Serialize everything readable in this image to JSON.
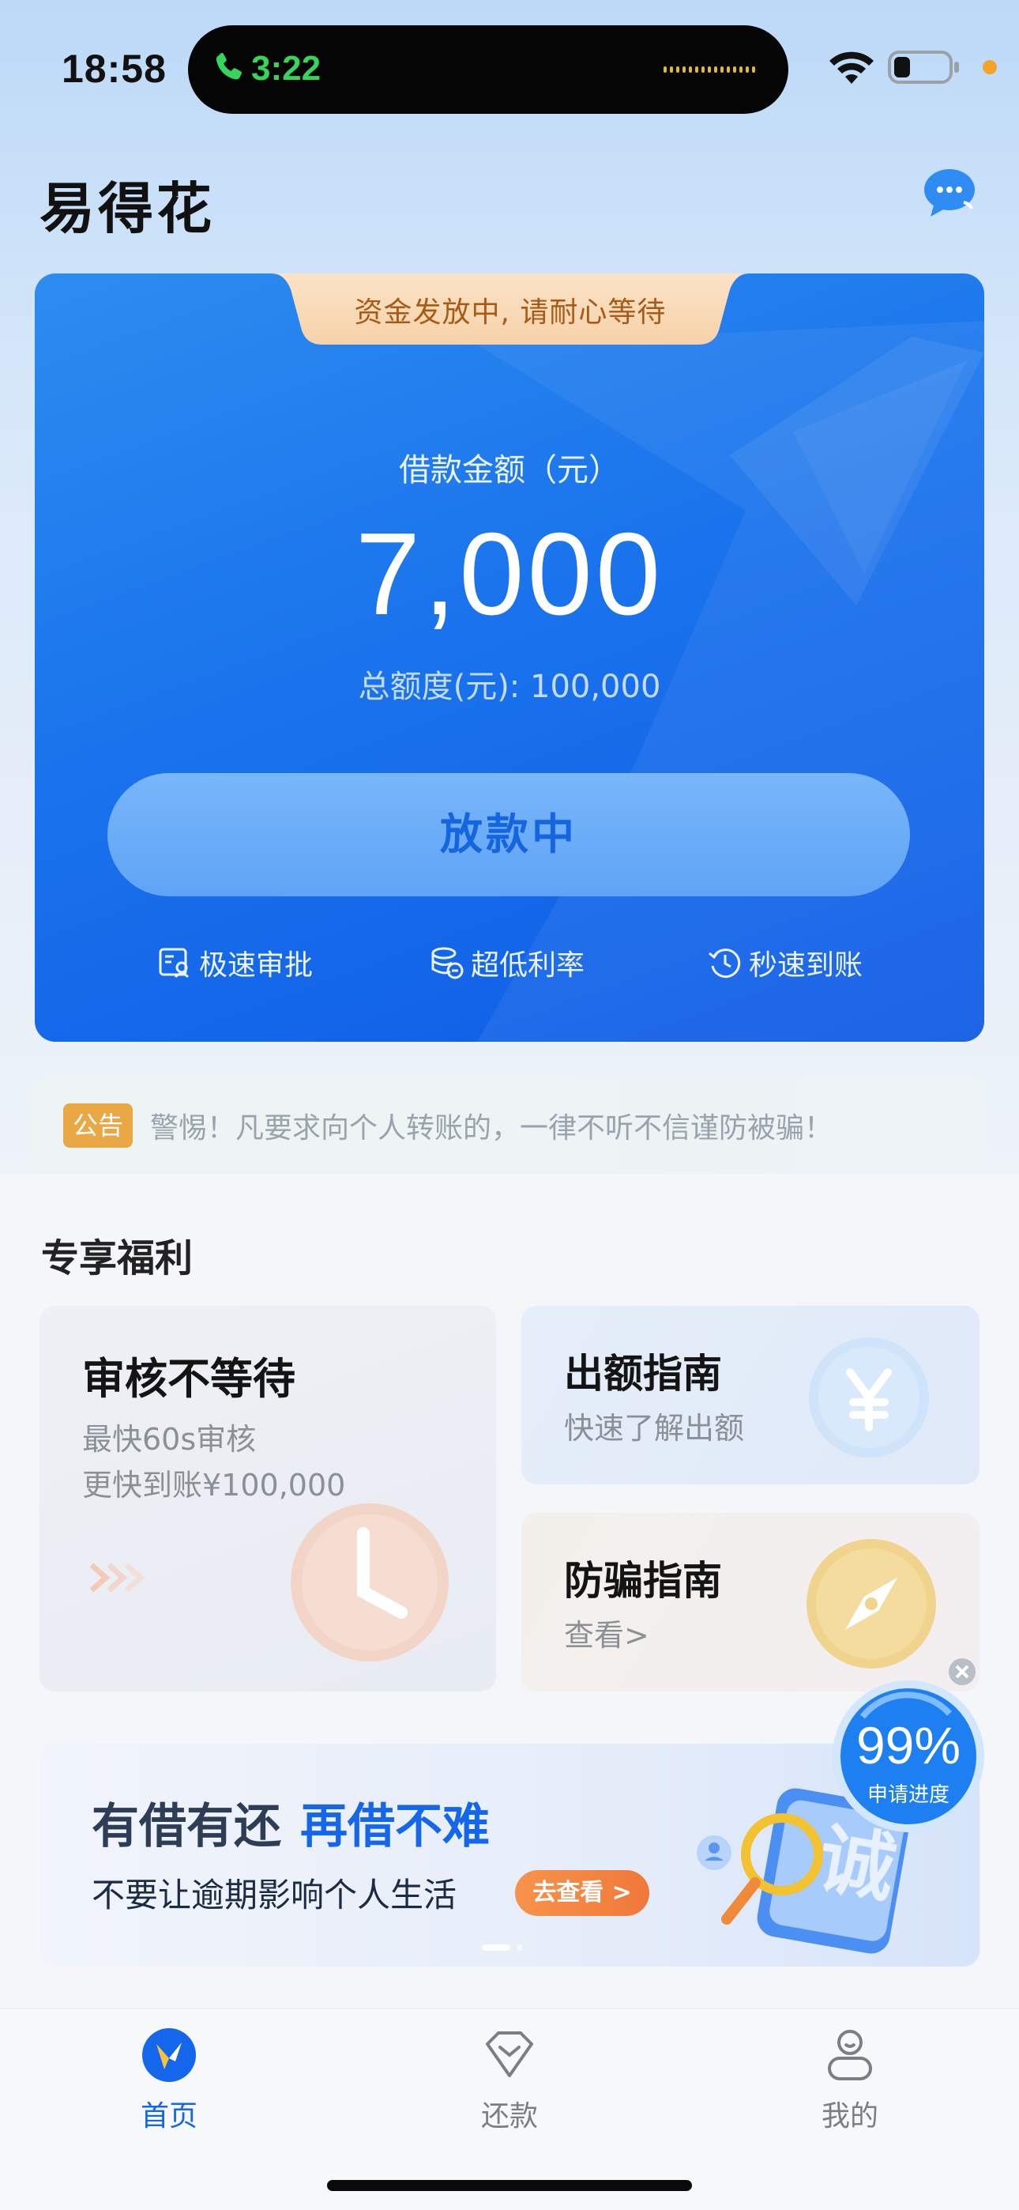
{
  "status_bar": {
    "time": "18:58",
    "call_time": "3:22",
    "call_color": "#35d45a"
  },
  "header": {
    "title": "易得花",
    "icon": "chat-bubble-icon"
  },
  "loan_card": {
    "notice": "资金发放中, 请耐心等待",
    "amount_label": "借款金额（元）",
    "amount": "7,000",
    "total_credit": "总额度(元): 100,000",
    "status_button": "放款中",
    "features": [
      {
        "icon": "review-icon",
        "label": "极速审批"
      },
      {
        "icon": "coins-icon",
        "label": "超低利率"
      },
      {
        "icon": "clock-icon",
        "label": "秒速到账"
      }
    ],
    "accent": "#1a73ec"
  },
  "announcement": {
    "badge": "公告",
    "text": "警惕！凡要求向个人转账的，一律不听不信谨防被骗！"
  },
  "benefits": {
    "title": "专享福利",
    "review_card": {
      "title": "审核不等待",
      "line1": "最快60s审核",
      "line2": "更快到账¥100,000"
    },
    "guide_card": {
      "title": "出额指南",
      "subtitle": "快速了解出额"
    },
    "fraud_card": {
      "title": "防骗指南",
      "subtitle": "查看>"
    }
  },
  "progress_float": {
    "value": "99%",
    "label": "申请进度"
  },
  "banner": {
    "title_part1": "有借有还",
    "title_part2": "再借不难",
    "subtitle": "不要让逾期影响个人生活",
    "button": "去查看 >"
  },
  "tabbar": {
    "items": [
      {
        "label": "首页",
        "icon": "home-logo-icon",
        "active": true
      },
      {
        "label": "还款",
        "icon": "repay-icon",
        "active": false
      },
      {
        "label": "我的",
        "icon": "profile-icon",
        "active": false
      }
    ],
    "active_color": "#1466ea",
    "inactive_color": "#7a7f87"
  }
}
